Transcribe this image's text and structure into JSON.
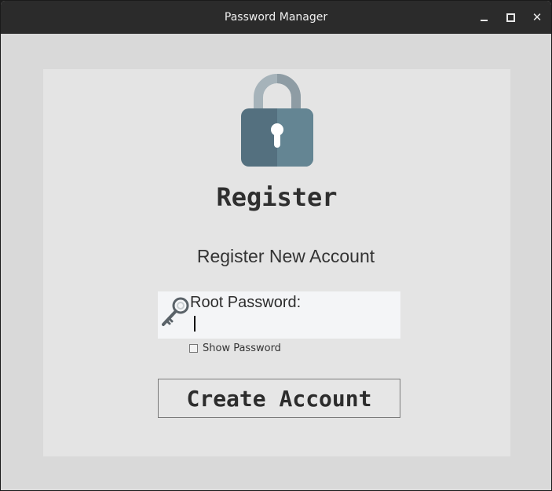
{
  "window": {
    "title": "Password Manager",
    "controls": [
      "minimize",
      "maximize",
      "close"
    ],
    "close_glyph": "✕"
  },
  "form": {
    "heading": "Register",
    "subheading": "Register New Account",
    "icons": {
      "lock": "lock-icon",
      "key": "key-icon"
    },
    "password_field": {
      "label": "Root Password:",
      "value": "",
      "placeholder": ""
    },
    "show_password": {
      "label": "Show Password",
      "checked": false
    },
    "submit_label": "Create Account"
  },
  "colors": {
    "lock_body": "#54707f",
    "lock_shackle": "#a6b3ba",
    "background": "#d9d9d9",
    "panel": "#e4e4e4",
    "field": "#f4f5f7"
  }
}
